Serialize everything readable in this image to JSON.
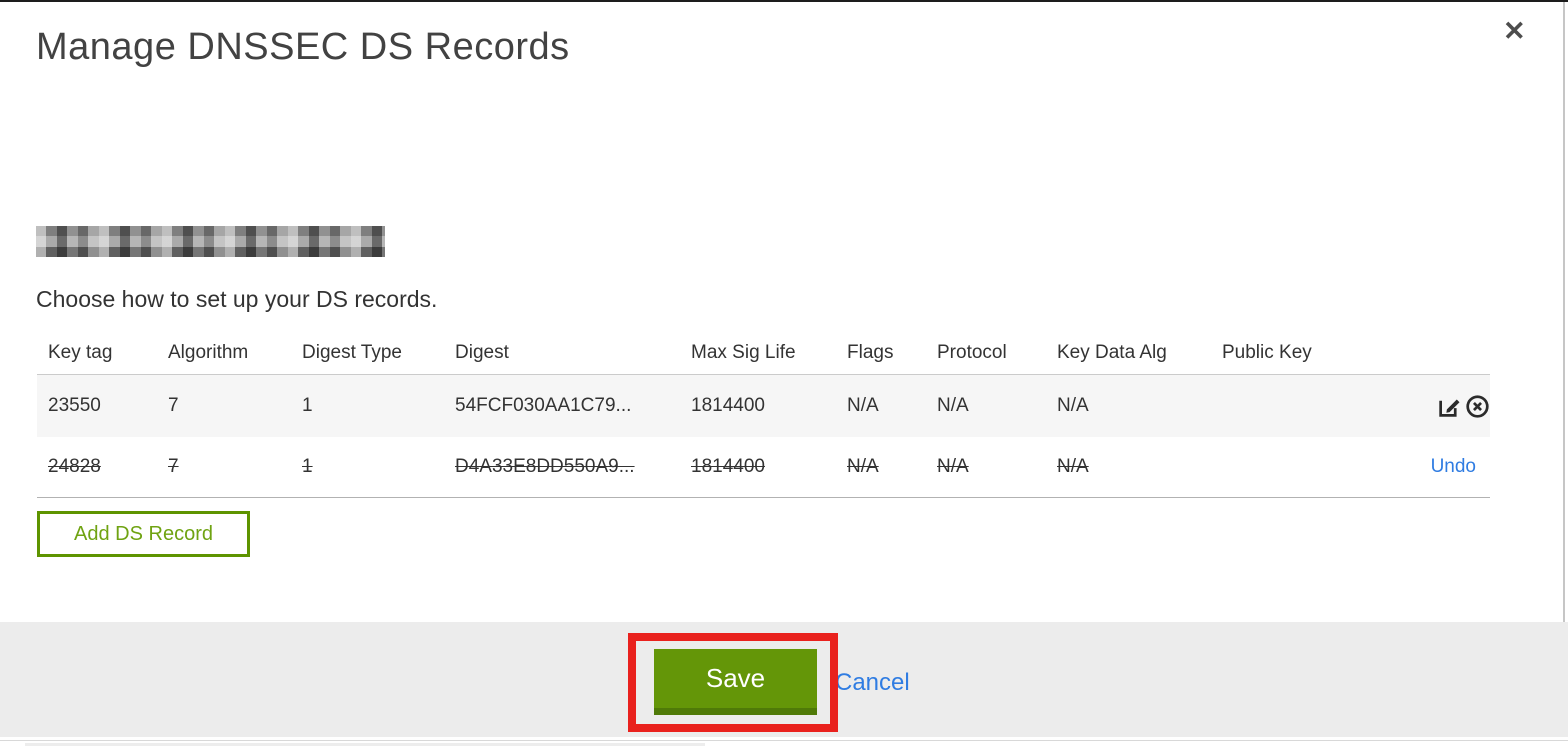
{
  "dialog": {
    "title": "Manage DNSSEC DS Records",
    "close_icon": "✕",
    "subtitle": "Choose how to set up your DS records."
  },
  "table": {
    "columns": [
      "Key tag",
      "Algorithm",
      "Digest Type",
      "Digest",
      "Max Sig Life",
      "Flags",
      "Protocol",
      "Key Data Alg",
      "Public Key"
    ],
    "rows": [
      {
        "key_tag": "23550",
        "algorithm": "7",
        "digest_type": "1",
        "digest": "54FCF030AA1C79...",
        "max_sig_life": "1814400",
        "flags": "N/A",
        "protocol": "N/A",
        "key_data_alg": "N/A",
        "public_key": "",
        "state": "active"
      },
      {
        "key_tag": "24828",
        "algorithm": "7",
        "digest_type": "1",
        "digest": "D4A33E8DD550A9...",
        "max_sig_life": "1814400",
        "flags": "N/A",
        "protocol": "N/A",
        "key_data_alg": "N/A",
        "public_key": "",
        "state": "deleted",
        "undo_label": "Undo"
      }
    ]
  },
  "buttons": {
    "add_ds_record": "Add DS Record",
    "save": "Save",
    "cancel": "Cancel"
  },
  "colors": {
    "save_button_green": "#649608",
    "save_button_bottom_green": "#4f7a08",
    "add_button_border_green": "#5e9400",
    "add_button_text_green": "#6fa312",
    "link_blue": "#2f7ce2",
    "annotation_red": "#e9211d",
    "row_highlight_gray": "#f6f6f6",
    "footer_gray": "#ececec"
  }
}
